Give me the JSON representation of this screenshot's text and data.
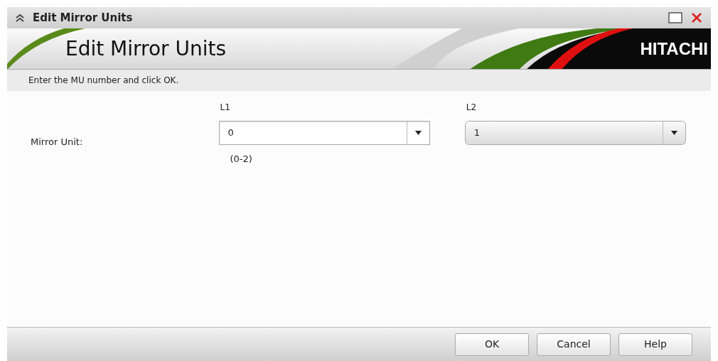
{
  "window": {
    "title": "Edit Mirror Units"
  },
  "banner": {
    "heading": "Edit Mirror Units",
    "logo": "HITACHI"
  },
  "instruction": "Enter the MU number and click OK.",
  "form": {
    "label": "Mirror Unit:",
    "fields": [
      {
        "kind": "combo",
        "column": "L1",
        "value": "0",
        "hint": "(0-2)"
      },
      {
        "kind": "select",
        "column": "L2",
        "value": "1"
      }
    ]
  },
  "buttons": [
    "OK",
    "Cancel",
    "Help"
  ]
}
